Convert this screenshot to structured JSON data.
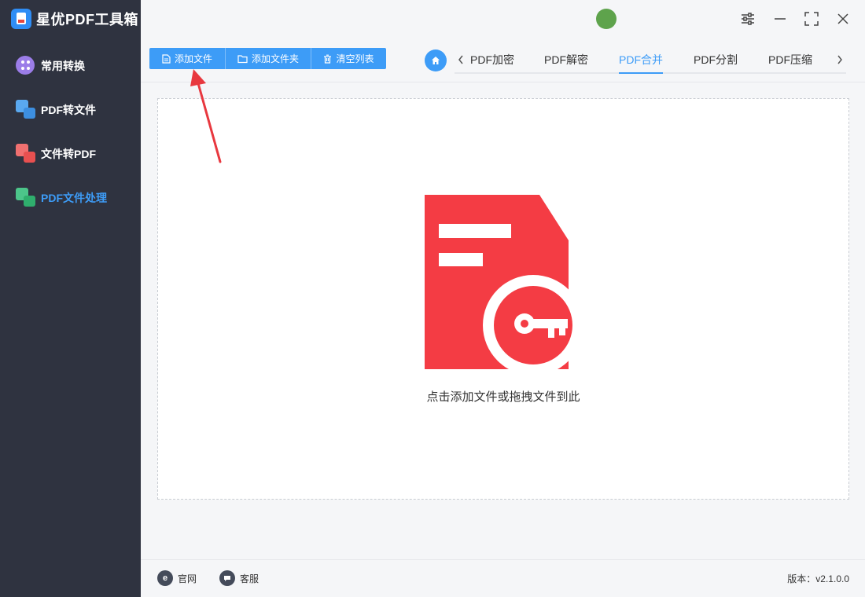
{
  "app": {
    "title": "星优PDF工具箱"
  },
  "sidebar": {
    "items": [
      {
        "label": "常用转换",
        "icon": "grid-dots-icon",
        "active": false
      },
      {
        "label": "PDF转文件",
        "icon": "pdf-to-file-icon",
        "active": false
      },
      {
        "label": "文件转PDF",
        "icon": "file-to-pdf-icon",
        "active": false
      },
      {
        "label": "PDF文件处理",
        "icon": "pdf-process-icon",
        "active": true
      }
    ]
  },
  "user": {
    "name": ""
  },
  "toolbar": {
    "add_file": "添加文件",
    "add_folder": "添加文件夹",
    "clear_list": "清空列表"
  },
  "tabs": [
    {
      "label": "PDF加密",
      "active": false
    },
    {
      "label": "PDF解密",
      "active": false
    },
    {
      "label": "PDF合并",
      "active": true
    },
    {
      "label": "PDF分割",
      "active": false
    },
    {
      "label": "PDF压缩",
      "active": false
    }
  ],
  "dropzone": {
    "text": "点击添加文件或拖拽文件到此"
  },
  "footer": {
    "website": "官网",
    "support": "客服",
    "version": "版本：v2.1.0.0"
  },
  "colors": {
    "accent": "#3d9cf7",
    "sidebar_bg": "#2f3340",
    "illustration_red": "#f43c44",
    "annotation_red": "#e8383f"
  }
}
